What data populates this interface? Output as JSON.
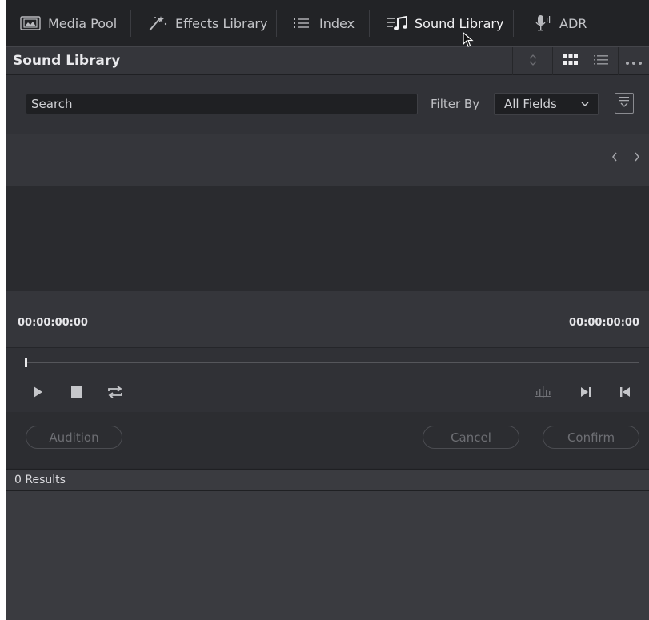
{
  "tabs": [
    {
      "label": "Media Pool",
      "icon": "media-pool-icon"
    },
    {
      "label": "Effects Library",
      "icon": "effects-wand-icon"
    },
    {
      "label": "Index",
      "icon": "index-list-icon"
    },
    {
      "label": "Sound Library",
      "icon": "sound-library-icon",
      "active": true
    },
    {
      "label": "ADR",
      "icon": "microphone-icon"
    }
  ],
  "panel": {
    "title": "Sound Library"
  },
  "search": {
    "value": "Search"
  },
  "filter": {
    "label": "Filter By",
    "selected": "All Fields"
  },
  "timecode": {
    "start": "00:00:00:00",
    "end": "00:00:00:00"
  },
  "actions": {
    "audition": "Audition",
    "cancel": "Cancel",
    "confirm": "Confirm"
  },
  "results": {
    "count_label": "0 Results"
  },
  "colors": {
    "background": "#2a2b2f",
    "tabbar": "#222326",
    "panel_header": "#35363b",
    "text_primary": "#e9e9ec",
    "text_disabled": "#6d6e73"
  }
}
